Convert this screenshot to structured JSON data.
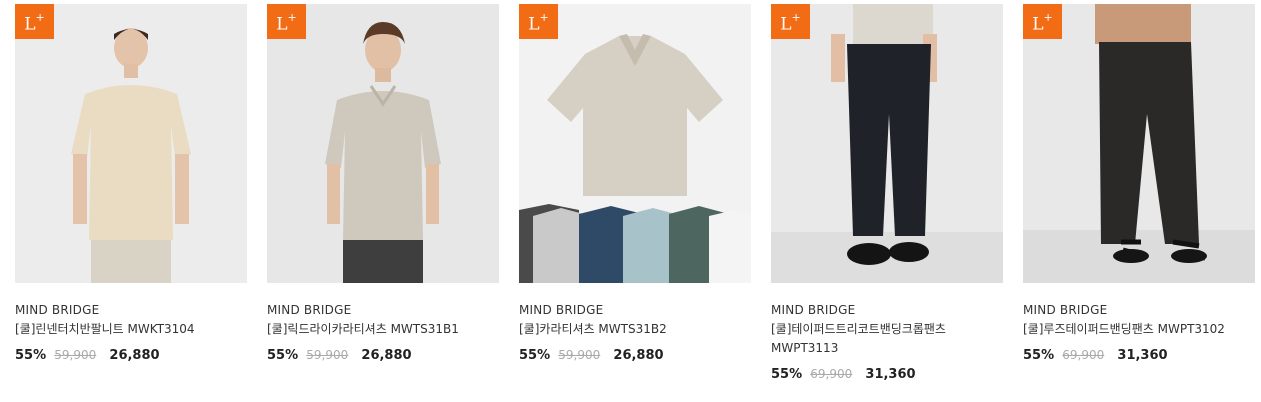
{
  "badge": {
    "letter": "L",
    "plus": "+"
  },
  "products": [
    {
      "brand": "MIND BRIDGE",
      "name": "[쿨]린넨터치반팔니트 MWKT3104",
      "discount": "55%",
      "original_price": "59,900",
      "sale_price": "26,880"
    },
    {
      "brand": "MIND BRIDGE",
      "name": "[쿨]릭드라이카라티셔츠 MWTS31B1",
      "discount": "55%",
      "original_price": "59,900",
      "sale_price": "26,880"
    },
    {
      "brand": "MIND BRIDGE",
      "name": "[쿨]카라티셔츠 MWTS31B2",
      "discount": "55%",
      "original_price": "59,900",
      "sale_price": "26,880"
    },
    {
      "brand": "MIND BRIDGE",
      "name": "[쿨]테이퍼드트리코트밴딩크롭팬츠 MWPT3113",
      "discount": "55%",
      "original_price": "69,900",
      "sale_price": "31,360"
    },
    {
      "brand": "MIND BRIDGE",
      "name": "[쿨]루즈테이퍼드밴딩팬츠 MWPT3102",
      "discount": "55%",
      "original_price": "69,900",
      "sale_price": "31,360"
    }
  ],
  "colors": {
    "badge": "#f26b15"
  }
}
